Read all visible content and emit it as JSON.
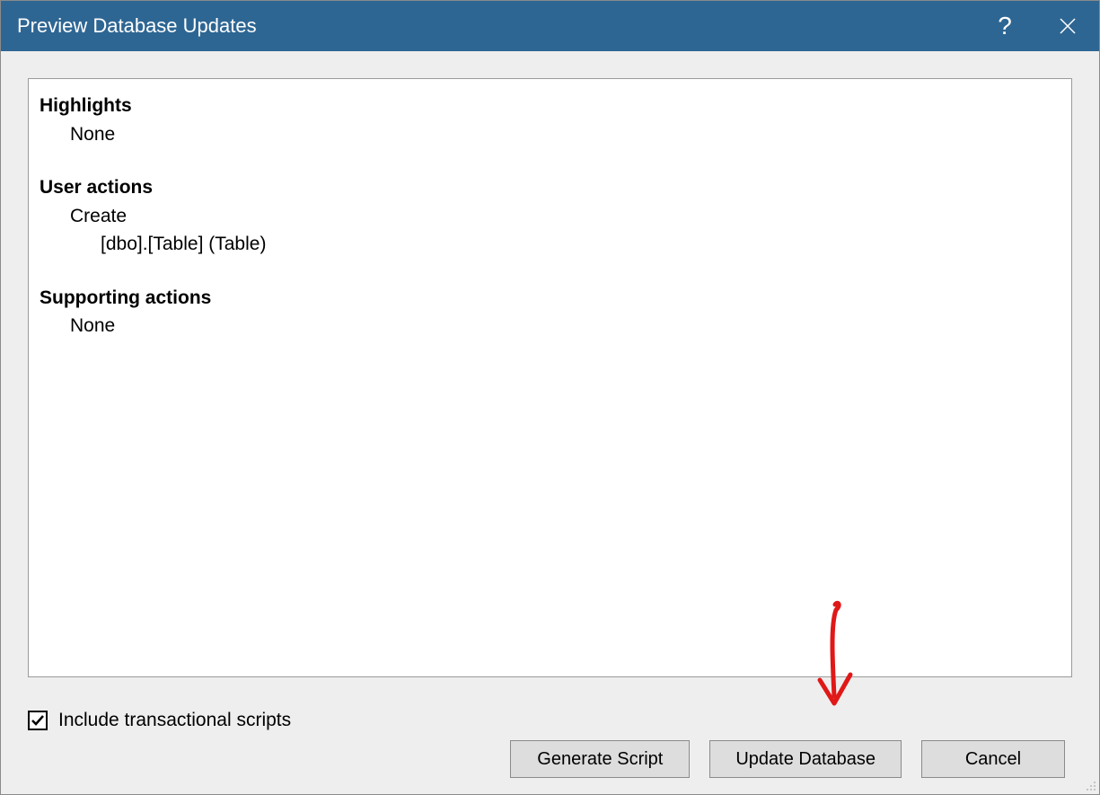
{
  "titlebar": {
    "title": "Preview Database Updates",
    "help_label": "?",
    "close_label": "Close"
  },
  "content": {
    "highlights_heading": "Highlights",
    "highlights_value": "None",
    "user_actions_heading": "User actions",
    "user_action_type": "Create",
    "user_action_item": "[dbo].[Table] (Table)",
    "supporting_heading": "Supporting actions",
    "supporting_value": "None"
  },
  "footer": {
    "checkbox_label": "Include transactional scripts",
    "checkbox_checked": true
  },
  "buttons": {
    "generate": "Generate Script",
    "update": "Update Database",
    "cancel": "Cancel"
  }
}
